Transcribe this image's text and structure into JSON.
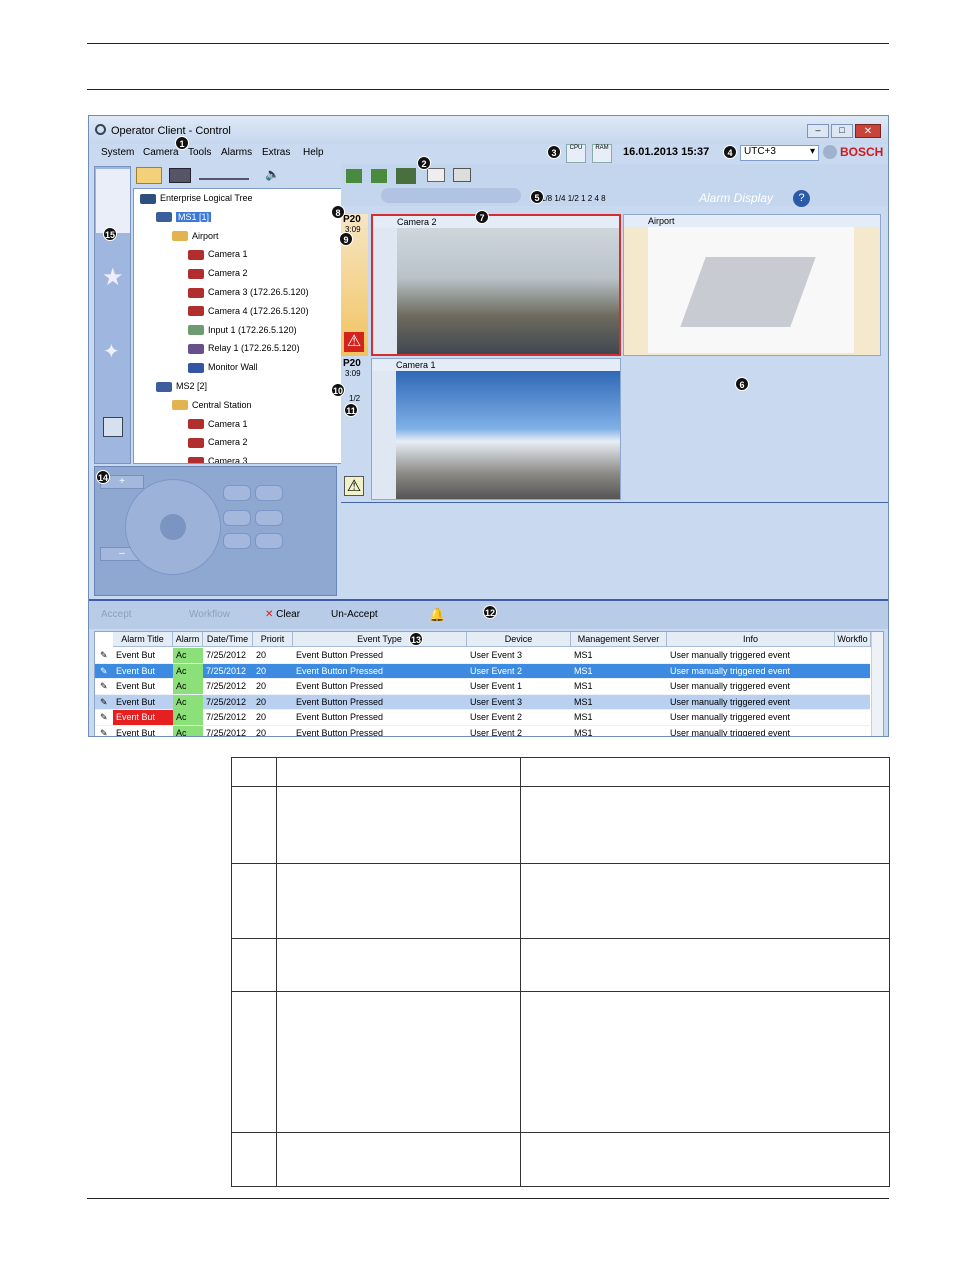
{
  "window": {
    "title": "Operator Client - Control",
    "menu": [
      "System",
      "Camera",
      "Tools",
      "Alarms",
      "Extras",
      "Help"
    ],
    "datetime": "16.01.2013 15:37",
    "timezone": "UTC+3",
    "brand": "BOSCH",
    "cpu_label": "CPU",
    "ram_label": "RAM"
  },
  "tree": {
    "rows": [
      {
        "label": "Enterprise Logical Tree",
        "icon": "globe-icon"
      },
      {
        "label": "MS1 [1]",
        "icon": "server-icon"
      },
      {
        "label": "Airport",
        "icon": "map-folder-icon"
      },
      {
        "label": "Camera 1",
        "icon": "camera-icon"
      },
      {
        "label": "Camera 2",
        "icon": "camera-icon"
      },
      {
        "label": "Camera 3 (172.26.5.120)",
        "icon": "camera-icon"
      },
      {
        "label": "Camera 4 (172.26.5.120)",
        "icon": "camera-icon"
      },
      {
        "label": "Input 1 (172.26.5.120)",
        "icon": "input-icon"
      },
      {
        "label": "Relay 1 (172.26.5.120)",
        "icon": "relay-icon"
      },
      {
        "label": "Monitor Wall",
        "icon": "monitor-wall-icon"
      },
      {
        "label": "MS2 [2]",
        "icon": "server-icon"
      },
      {
        "label": "Central Station",
        "icon": "map-folder-icon"
      },
      {
        "label": "Camera 1",
        "icon": "camera-icon"
      },
      {
        "label": "Camera 2",
        "icon": "camera-icon"
      },
      {
        "label": "Camera 3",
        "icon": "camera-icon"
      }
    ]
  },
  "viewer": {
    "alarm_display": "Alarm Display",
    "speeds": [
      "1/8",
      "1/4",
      "1/2",
      "1",
      "2",
      "4",
      "8"
    ],
    "pane1": {
      "priority": "P20",
      "time": "3:09",
      "title": "Camera 2"
    },
    "pane2": {
      "title": "Airport"
    },
    "pane3": {
      "priority": "P20",
      "time": "3:09",
      "page": "1/2",
      "title": "Camera 1"
    }
  },
  "alarm_toolbar": {
    "accept": "Accept",
    "workflow": "Workflow",
    "clear": "Clear",
    "unaccept": "Un-Accept"
  },
  "alarm_table": {
    "headers": [
      "Alarm Title",
      "Alarm",
      "Date/Time",
      "Priorit",
      "Event Type",
      "Device",
      "Management Server",
      "Info",
      "Workflo"
    ],
    "rows": [
      {
        "title": "Event But",
        "state": "Ac",
        "date": "7/25/2012",
        "prio": "20",
        "type": "Event Button Pressed",
        "device": "User Event 3",
        "server": "MS1",
        "info": "User manually triggered event",
        "style": "normal"
      },
      {
        "title": "Event But",
        "state": "Ac",
        "date": "7/25/2012",
        "prio": "20",
        "type": "Event Button Pressed",
        "device": "User Event 2",
        "server": "MS1",
        "info": "User manually triggered event",
        "style": "selected"
      },
      {
        "title": "Event But",
        "state": "Ac",
        "date": "7/25/2012",
        "prio": "20",
        "type": "Event Button Pressed",
        "device": "User Event 1",
        "server": "MS1",
        "info": "User manually triggered event",
        "style": "normal"
      },
      {
        "title": "Event But",
        "state": "Ac",
        "date": "7/25/2012",
        "prio": "20",
        "type": "Event Button Pressed",
        "device": "User Event 3",
        "server": "MS1",
        "info": "User manually triggered event",
        "style": "highlight"
      },
      {
        "title": "Event But",
        "state": "Ac",
        "date": "7/25/2012",
        "prio": "20",
        "type": "Event Button Pressed",
        "device": "User Event 2",
        "server": "MS1",
        "info": "User manually triggered event",
        "style": "red"
      },
      {
        "title": "Event But",
        "state": "Ac",
        "date": "7/25/2012",
        "prio": "20",
        "type": "Event Button Pressed",
        "device": "User Event 2",
        "server": "MS1",
        "info": "User manually triggered event",
        "style": "normal"
      }
    ]
  },
  "markers": [
    "1",
    "2",
    "3",
    "4",
    "5",
    "6",
    "7",
    "8",
    "9",
    "10",
    "11",
    "12",
    "13",
    "14",
    "15"
  ]
}
